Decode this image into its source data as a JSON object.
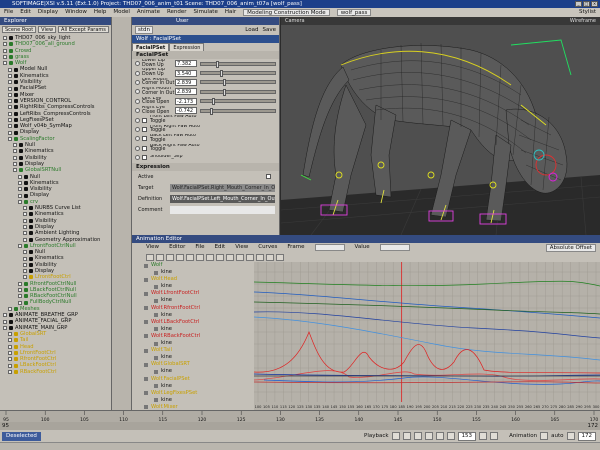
{
  "app": {
    "title": "SOFTIMAGE|XSI v.5.11 (Ext.1.0) Project: THD07_006_anim_t01   Scene: THD07_006_anim_t07a   [wolf_pass]",
    "window_buttons": [
      "_",
      "□",
      "×"
    ]
  },
  "menubar": {
    "items": [
      "File",
      "Edit",
      "Display",
      "Window",
      "Help",
      "Model",
      "Animate",
      "Render",
      "Simulate",
      "Hair"
    ],
    "mode_field": "Modeling Construction Mode",
    "pass_field": "wolf_pass",
    "right_label": "Stylist"
  },
  "explorer": {
    "title": "Explorer",
    "tools": [
      "Scene Root",
      "View",
      "All Except Params"
    ],
    "items": [
      {
        "label": "THD07_006_sky_light",
        "color": "#111111",
        "indent": 0
      },
      {
        "label": "THD07_006_all_ground",
        "color": "#2a7a2a",
        "indent": 0
      },
      {
        "label": "Crowd",
        "color": "#2a7a2a",
        "indent": 0
      },
      {
        "label": "grass",
        "color": "#2a7a2a",
        "indent": 0
      },
      {
        "label": "Wolf",
        "color": "#2a7a2a",
        "indent": 0
      },
      {
        "label": "Model Null",
        "color": "#111111",
        "indent": 1
      },
      {
        "label": "Kinematics",
        "color": "#111111",
        "indent": 1
      },
      {
        "label": "Visibility",
        "color": "#111111",
        "indent": 1
      },
      {
        "label": "FacialPSet",
        "color": "#111111",
        "indent": 1
      },
      {
        "label": "Mixer",
        "color": "#111111",
        "indent": 1
      },
      {
        "label": "VERSION_CONTROL",
        "color": "#111111",
        "indent": 1
      },
      {
        "label": "RightRibs_CompressControls",
        "color": "#111111",
        "indent": 1
      },
      {
        "label": "LeftRibs_CompressControls",
        "color": "#111111",
        "indent": 1
      },
      {
        "label": "LegFixesPSet",
        "color": "#111111",
        "indent": 1
      },
      {
        "label": "Wolf_v04b_SymMap",
        "color": "#111111",
        "indent": 1
      },
      {
        "label": "Display",
        "color": "#111111",
        "indent": 1
      },
      {
        "label": "ScalingFactor",
        "color": "#2a7a2a",
        "indent": 1
      },
      {
        "label": "Null",
        "color": "#111111",
        "indent": 2
      },
      {
        "label": "Kinematics",
        "color": "#111111",
        "indent": 2
      },
      {
        "label": "Visibility",
        "color": "#111111",
        "indent": 2
      },
      {
        "label": "Display",
        "color": "#111111",
        "indent": 2
      },
      {
        "label": "GlobalSRTNull",
        "color": "#2a7a2a",
        "indent": 2
      },
      {
        "label": "Null",
        "color": "#111111",
        "indent": 3
      },
      {
        "label": "Kinematics",
        "color": "#111111",
        "indent": 3
      },
      {
        "label": "Visibility",
        "color": "#111111",
        "indent": 3
      },
      {
        "label": "Display",
        "color": "#111111",
        "indent": 3
      },
      {
        "label": "crv",
        "color": "#2a7a2a",
        "indent": 3
      },
      {
        "label": "NURBS Curve List",
        "color": "#111111",
        "indent": 4
      },
      {
        "label": "Kinematics",
        "color": "#111111",
        "indent": 4
      },
      {
        "label": "Visibility",
        "color": "#111111",
        "indent": 4
      },
      {
        "label": "Display",
        "color": "#111111",
        "indent": 4
      },
      {
        "label": "Ambient Lighting",
        "color": "#111111",
        "indent": 4
      },
      {
        "label": "Geometry Approximation",
        "color": "#111111",
        "indent": 4
      },
      {
        "label": "LfrontFootCtrlNull",
        "color": "#2a7a2a",
        "indent": 3
      },
      {
        "label": "Null",
        "color": "#111111",
        "indent": 4
      },
      {
        "label": "Kinematics",
        "color": "#111111",
        "indent": 4
      },
      {
        "label": "Visibility",
        "color": "#111111",
        "indent": 4
      },
      {
        "label": "Display",
        "color": "#111111",
        "indent": 4
      },
      {
        "label": "LfrontFootCtrl",
        "color": "#c8a000",
        "indent": 4
      },
      {
        "label": "RfrontFootCtrlNull",
        "color": "#2a7a2a",
        "indent": 3
      },
      {
        "label": "LBackFootCtrlNull",
        "color": "#2a7a2a",
        "indent": 3
      },
      {
        "label": "RBackFootCtrlNull",
        "color": "#2a7a2a",
        "indent": 3
      },
      {
        "label": "FullBodyCtrlNull",
        "color": "#2a7a2a",
        "indent": 3
      },
      {
        "label": "Meshes",
        "color": "#2a7a2a",
        "indent": 1
      },
      {
        "label": "ANIMATE_BREATHE_GRP",
        "color": "#111111",
        "indent": 0
      },
      {
        "label": "ANIMATE_FACIAL_GRP",
        "color": "#111111",
        "indent": 0
      },
      {
        "label": "ANIMATE_MAIN_GRP",
        "color": "#111111",
        "indent": 0
      },
      {
        "label": "GlobalSRT",
        "color": "#c8a000",
        "indent": 1
      },
      {
        "label": "Tail",
        "color": "#c8a000",
        "indent": 1
      },
      {
        "label": "Head",
        "color": "#c8a000",
        "indent": 1
      },
      {
        "label": "LfrontFootCtrl",
        "color": "#c8a000",
        "indent": 1
      },
      {
        "label": "RfrontFootCtrl",
        "color": "#c8a000",
        "indent": 1
      },
      {
        "label": "LBackFootCtrl",
        "color": "#c8a000",
        "indent": 1
      },
      {
        "label": "RBackFootCtrl",
        "color": "#c8a000",
        "indent": 1
      }
    ]
  },
  "property_editor": {
    "user_label": "User",
    "preset_field": "stdn",
    "buttons": [
      "Load",
      "Save"
    ],
    "title": "Wolf : FacialPSet",
    "tabs": [
      "FacialPSet",
      "Expression"
    ],
    "section1": "FacialPSet",
    "params": [
      {
        "label": "Lower Lip Down Up",
        "value": "7.382",
        "knob": 0.2
      },
      {
        "label": "Upper Lip Down Up",
        "value": "3.540",
        "knob": 0.25
      },
      {
        "label": "Left Mouth Corner In Out",
        "value": "2.839",
        "knob": 0.3
      },
      {
        "label": "Right Mouth Corner In Out",
        "value": "2.839",
        "knob": 0.3
      },
      {
        "label": "Left Eye Close Open",
        "value": "-2.173",
        "knob": 0.15
      },
      {
        "label": "Right Eye Close Open",
        "value": "-0.742",
        "knob": 0.12
      }
    ],
    "checks": [
      {
        "label": "Front Left Paw Auto Toggle"
      },
      {
        "label": "Front Right Paw Auto Toggle"
      },
      {
        "label": "Back Left Paw Auto Toggle"
      },
      {
        "label": "Back Right Paw Auto Toggle"
      },
      {
        "label": "Shoulder_Slip"
      }
    ],
    "section2": "Expression",
    "expr": {
      "active_label": "Active",
      "target_label": "Target",
      "target_value": "Wolf.FacialPSet.Right_Mouth_Corner_In_Out",
      "definition_label": "Definition",
      "definition_value": "Wolf.FacialPSet.Left_Mouth_Corner_In_Out",
      "comment_label": "Comment"
    }
  },
  "viewport": {
    "label": "Camera",
    "right_label": "Wireframe"
  },
  "animation_editor": {
    "title": "Animation Editor",
    "menu": [
      "View",
      "Editor",
      "File",
      "Edit",
      "View",
      "Curves"
    ],
    "frame_label": "Frame",
    "value_label": "Value",
    "abs_offset": "Absolute Offset",
    "list": [
      {
        "label": "Wolf",
        "color": "#2a7a2a"
      },
      {
        "label": "kine",
        "color": "#111111"
      },
      {
        "label": "Wolf.Head",
        "color": "#c8a000"
      },
      {
        "label": "kine",
        "color": "#111111"
      },
      {
        "label": "Wolf.LfrontFootCtrl",
        "color": "#c82020"
      },
      {
        "label": "kine",
        "color": "#111111"
      },
      {
        "label": "Wolf.RfrontFootCtrl",
        "color": "#c82020"
      },
      {
        "label": "kine",
        "color": "#111111"
      },
      {
        "label": "Wolf.LBackFootCtrl",
        "color": "#c82020"
      },
      {
        "label": "kine",
        "color": "#111111"
      },
      {
        "label": "Wolf.RBackFootCtrl",
        "color": "#c82020"
      },
      {
        "label": "kine",
        "color": "#111111"
      },
      {
        "label": "Wolf.Tail",
        "color": "#c8a000"
      },
      {
        "label": "kine",
        "color": "#111111"
      },
      {
        "label": "Wolf.GlobalSRT",
        "color": "#c8a000"
      },
      {
        "label": "kine",
        "color": "#111111"
      },
      {
        "label": "Wolf.FacialPSet",
        "color": "#c8a000"
      },
      {
        "label": "kine",
        "color": "#111111"
      },
      {
        "label": "Wolf.LegFixesPSet",
        "color": "#c8a000"
      },
      {
        "label": "kine",
        "color": "#111111"
      },
      {
        "label": "Wolf.Mixer",
        "color": "#c8a000"
      }
    ],
    "x_ticks": [
      "100",
      "105",
      "110",
      "115",
      "120",
      "125",
      "130",
      "135",
      "140",
      "145",
      "150",
      "155",
      "160",
      "165",
      "170",
      "175",
      "180",
      "185",
      "190",
      "195",
      "200",
      "205",
      "210",
      "215",
      "220",
      "225",
      "230",
      "235",
      "240",
      "245",
      "250",
      "255",
      "260",
      "265",
      "270",
      "275",
      "280",
      "285",
      "290",
      "295",
      "300"
    ],
    "current_frame_marker": "185"
  },
  "timeline": {
    "start": "95",
    "end": "172",
    "range_start": "95",
    "range_end": "172",
    "ticks": [
      "95",
      "100",
      "105",
      "110",
      "115",
      "120",
      "125",
      "130",
      "135",
      "140",
      "145",
      "150",
      "155",
      "160",
      "165",
      "170"
    ]
  },
  "playbar": {
    "selection": "Deselected",
    "playback_label": "Playback",
    "current_frame": "153",
    "animation_label": "Animation",
    "auto_label": "auto",
    "end_frame": "172"
  }
}
